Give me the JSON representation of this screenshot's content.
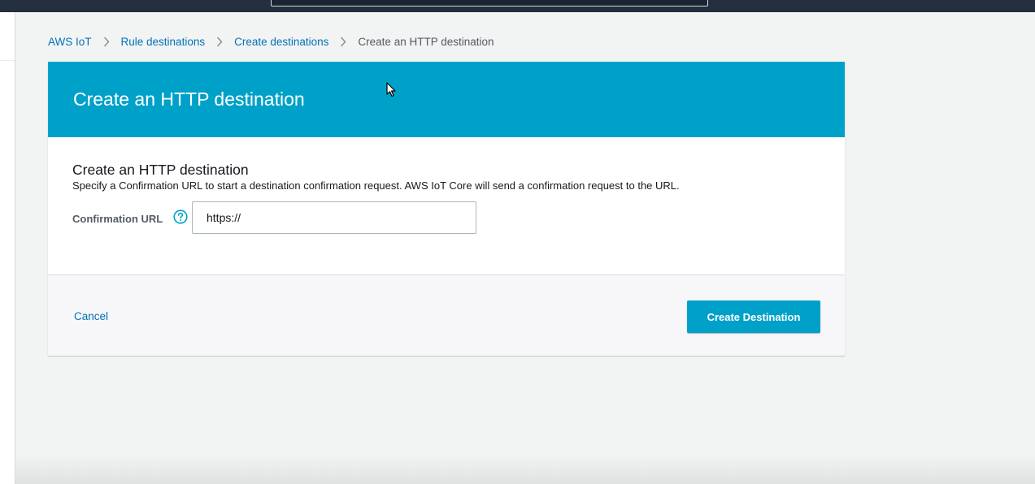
{
  "breadcrumb": {
    "items": [
      {
        "label": "AWS IoT"
      },
      {
        "label": "Rule destinations"
      },
      {
        "label": "Create destinations"
      }
    ],
    "current": "Create an HTTP destination"
  },
  "header": {
    "title": "Create an HTTP destination"
  },
  "form": {
    "section_title": "Create an HTTP destination",
    "description": "Specify a Confirmation URL to start a destination confirmation request. AWS IoT Core will send a confirmation request to the URL.",
    "confirmation_url_label": "Confirmation URL",
    "confirmation_url_value": "https://",
    "help_icon": "question-circle-icon"
  },
  "footer": {
    "cancel_label": "Cancel",
    "create_label": "Create Destination"
  },
  "colors": {
    "accent": "#00a1c9",
    "link": "#0073bb",
    "topbar": "#232f3e"
  }
}
